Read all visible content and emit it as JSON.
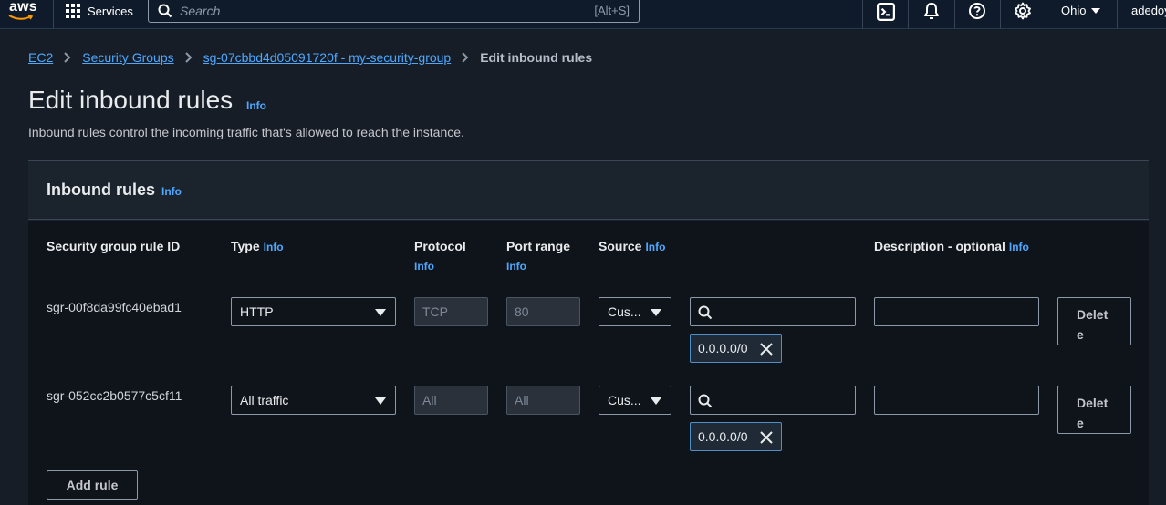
{
  "nav": {
    "logo_text": "aws",
    "services_label": "Services",
    "search_placeholder": "Search",
    "search_shortcut": "[Alt+S]",
    "region_label": "Ohio",
    "user_label": "adedoy",
    "icons": [
      "cloudshell-icon",
      "bell-icon",
      "help-icon",
      "settings-icon"
    ]
  },
  "breadcrumb": {
    "items": [
      "EC2",
      "Security Groups",
      "sg-07cbbd4d05091720f - my-security-group"
    ],
    "current": "Edit inbound rules"
  },
  "page": {
    "title": "Edit inbound rules",
    "info": "Info",
    "subtitle": "Inbound rules control the incoming traffic that's allowed to reach the instance."
  },
  "panel": {
    "title": "Inbound rules",
    "info": "Info"
  },
  "columns": {
    "rule_id": "Security group rule ID",
    "type": "Type",
    "protocol": "Protocol",
    "port_range": "Port range",
    "source": "Source",
    "description": "Description - optional",
    "info": "Info"
  },
  "rules": [
    {
      "id": "sgr-00f8da99fc40ebad1",
      "type": "HTTP",
      "protocol": "TCP",
      "port": "80",
      "source": "Cus...",
      "cidr": "0.0.0.0/0",
      "delete": "Delete"
    },
    {
      "id": "sgr-052cc2b0577c5cf11",
      "type": "All traffic",
      "protocol": "All",
      "port": "All",
      "source": "Cus...",
      "cidr": "0.0.0.0/0",
      "delete": "Delete"
    }
  ],
  "actions": {
    "add_rule": "Add rule"
  },
  "colors": {
    "link": "#4fa8ff",
    "background": "#161d26",
    "nav": "#0f1b2a"
  }
}
